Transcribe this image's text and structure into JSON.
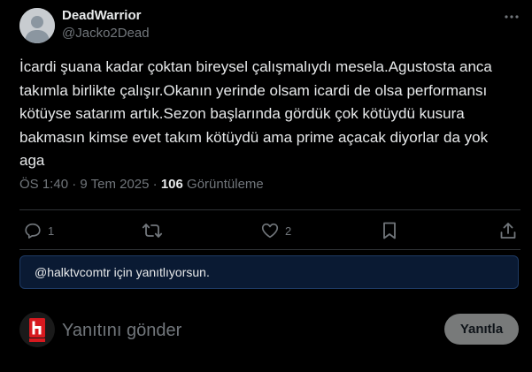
{
  "author": {
    "display_name": "DeadWarrior",
    "handle": "@Jacko2Dead"
  },
  "tweet": {
    "lines": [
      "İcardi şuana kadar çoktan bireysel çalışmalıydı mesela.Agustosta anca",
      "takımla birlikte çalışır.Okanın yerinde olsam icardi de olsa performansı",
      "kötüyse satarım artık.Sezon başlarında gördük çok kötüydü kusura",
      "bakmasın kimse evet takım kötüydü ama prime açacak diyorlar da yok",
      "aga"
    ],
    "time": "ÖS 1:40",
    "separator": "·",
    "date": "9 Tem 2025",
    "views_count": "106",
    "views_label": "Görüntüleme"
  },
  "actions": {
    "replies": "1",
    "reposts": "",
    "likes": "2"
  },
  "reply_context": {
    "text": "@halktvcomtr için yanıtlıyorsun."
  },
  "composer": {
    "placeholder": "Yanıtını gönder",
    "value": "",
    "button_label": "Yanıtla"
  },
  "colors": {
    "background": "#000000",
    "text_primary": "#e7e9ea",
    "text_secondary": "#71767b",
    "divider": "#2f3336",
    "reply_banner_bg": "#0a1a33",
    "reply_button_bg": "#787a7a"
  },
  "icons": {
    "more": "more-horizontal-icon",
    "reply": "reply-icon",
    "repost": "repost-icon",
    "like": "like-icon",
    "bookmark": "bookmark-icon",
    "share": "share-icon"
  }
}
